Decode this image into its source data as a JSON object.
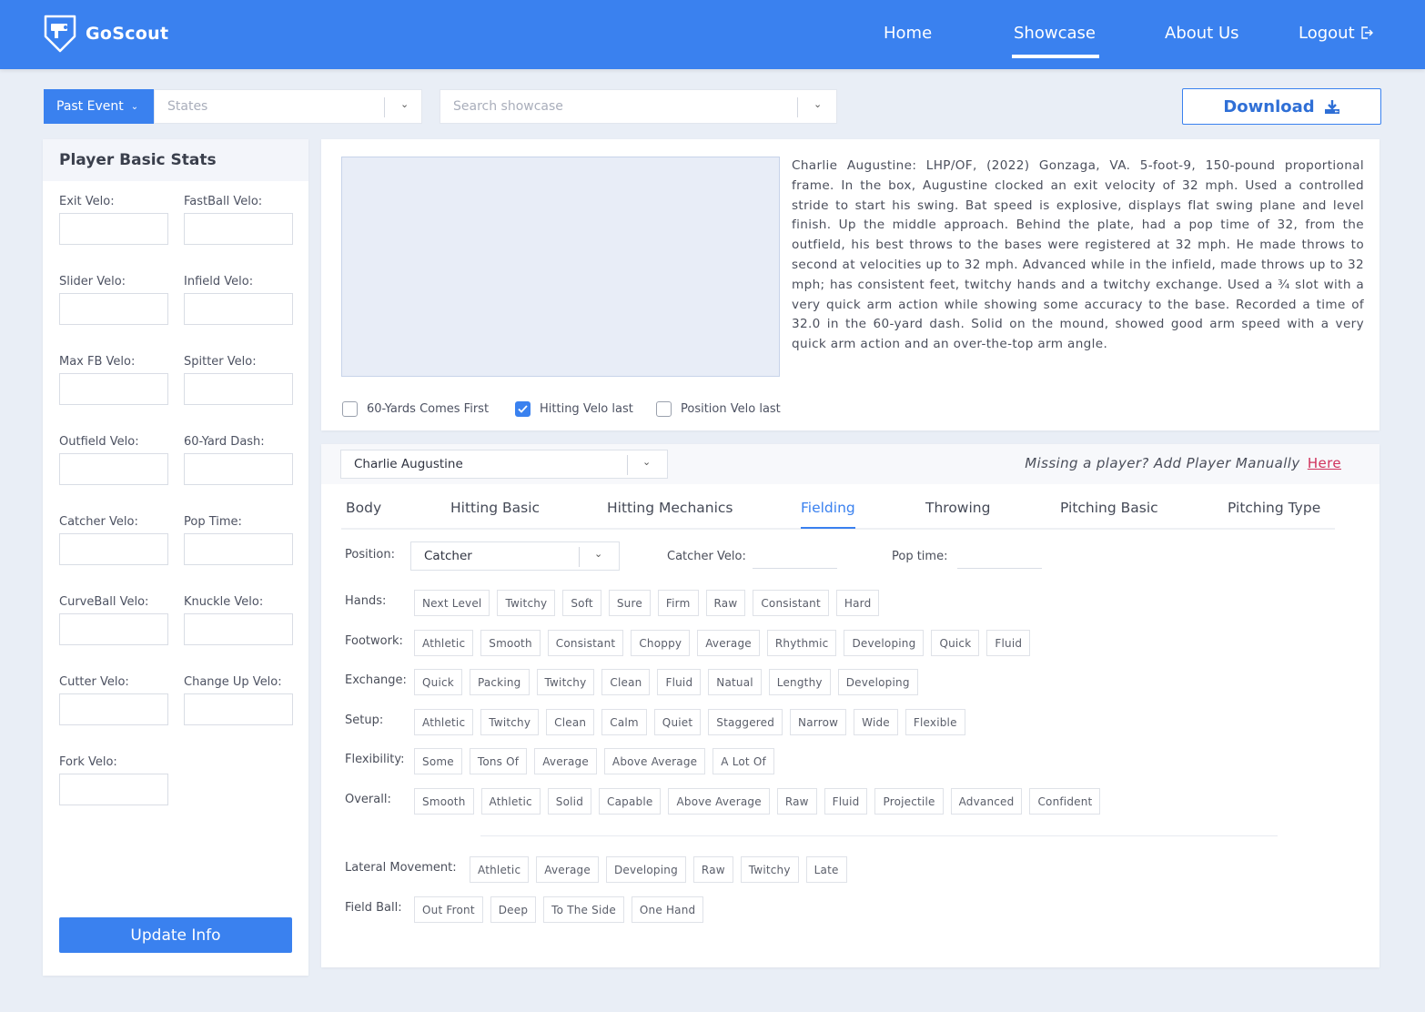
{
  "header": {
    "brand": "GoScout",
    "nav": [
      {
        "label": "Home",
        "active": false
      },
      {
        "label": "Showcase",
        "active": true
      },
      {
        "label": "About Us",
        "active": false
      },
      {
        "label": "Logout",
        "active": false
      }
    ]
  },
  "filters": {
    "event_label": "Past Event",
    "states_placeholder": "States",
    "search_placeholder": "Search showcase",
    "download_label": "Download"
  },
  "stats": {
    "title": "Player Basic Stats",
    "fields": [
      {
        "label": "Exit Velo:",
        "value": ""
      },
      {
        "label": "FastBall Velo:",
        "value": ""
      },
      {
        "label": "Slider Velo:",
        "value": ""
      },
      {
        "label": "Infield Velo:",
        "value": ""
      },
      {
        "label": "Max FB Velo:",
        "value": ""
      },
      {
        "label": "Spitter Velo:",
        "value": ""
      },
      {
        "label": "Outfield Velo:",
        "value": ""
      },
      {
        "label": "60-Yard Dash:",
        "value": ""
      },
      {
        "label": "Catcher Velo:",
        "value": ""
      },
      {
        "label": "Pop Time:",
        "value": ""
      },
      {
        "label": "CurveBall Velo:",
        "value": ""
      },
      {
        "label": "Knuckle Velo:",
        "value": ""
      },
      {
        "label": "Cutter Velo:",
        "value": ""
      },
      {
        "label": "Change Up Velo:",
        "value": ""
      },
      {
        "label": "Fork Velo:",
        "value": ""
      }
    ],
    "update_label": "Update Info"
  },
  "description": {
    "text": "Charlie Augustine: LHP/OF, (2022) Gonzaga, VA. 5-foot-9, 150-pound proportional frame. In the box, Augustine clocked an exit velocity of 32 mph. Used a controlled stride to start his swing. Bat speed is explosive, displays flat  swing plane and level finish. Up the middle approach. Behind the plate, had a pop time of 32, from the outfield, his best throws to the bases were registered at 32 mph. He made throws to second at velocities up to 32 mph. Advanced while in the infield, made throws up to 32 mph; has consistent feet, twitchy hands and a twitchy exchange. Used a ¾ slot with a very quick arm action while showing some accuracy to the base. Recorded a time of 32.0 in the 60-yard dash. Solid on the mound, showed good arm speed with a very quick arm action and an over-the-top arm angle.",
    "options": [
      {
        "label": "60-Yards Comes First",
        "checked": false
      },
      {
        "label": "Hitting Velo last",
        "checked": true
      },
      {
        "label": "Position Velo last",
        "checked": false
      }
    ]
  },
  "detail": {
    "player": "Charlie Augustine",
    "missing_text": "Missing a player? Add Player Manually",
    "missing_link": "Here",
    "tabs": [
      {
        "label": "Body",
        "active": false
      },
      {
        "label": "Hitting Basic",
        "active": false
      },
      {
        "label": "Hitting Mechanics",
        "active": false
      },
      {
        "label": "Fielding",
        "active": true
      },
      {
        "label": "Throwing",
        "active": false
      },
      {
        "label": "Pitching Basic",
        "active": false
      },
      {
        "label": "Pitching Type",
        "active": false
      }
    ],
    "position_label": "Position:",
    "position_value": "Catcher",
    "catcher_velo_label": "Catcher Velo:",
    "pop_time_label": "Pop time:",
    "groups": [
      {
        "label": "Hands:",
        "chips": [
          "Next Level",
          "Twitchy",
          "Soft",
          "Sure",
          "Firm",
          "Raw",
          "Consistant",
          "Hard"
        ]
      },
      {
        "label": "Footwork:",
        "chips": [
          "Athletic",
          "Smooth",
          "Consistant",
          "Choppy",
          "Average",
          "Rhythmic",
          "Developing",
          "Quick",
          "Fluid"
        ]
      },
      {
        "label": "Exchange:",
        "chips": [
          "Quick",
          "Packing",
          "Twitchy",
          "Clean",
          "Fluid",
          "Natual",
          "Lengthy",
          "Developing"
        ]
      },
      {
        "label": "Setup:",
        "chips": [
          "Athletic",
          "Twitchy",
          "Clean",
          "Calm",
          "Quiet",
          "Staggered",
          "Narrow",
          "Wide",
          "Flexible"
        ]
      },
      {
        "label": "Flexibility:",
        "chips": [
          "Some",
          "Tons Of",
          "Average",
          "Above Average",
          "A Lot Of"
        ]
      },
      {
        "label": "Overall:",
        "chips": [
          "Smooth",
          "Athletic",
          "Solid",
          "Capable",
          "Above Average",
          "Raw",
          "Fluid",
          "Projectile",
          "Advanced",
          "Confident"
        ]
      },
      {
        "label": "Lateral Movement:",
        "chips": [
          "Athletic",
          "Average",
          "Developing",
          "Raw",
          "Twitchy",
          "Late"
        ]
      },
      {
        "label": "Field Ball:",
        "chips": [
          "Out Front",
          "Deep",
          "To The Side",
          "One Hand"
        ]
      }
    ]
  }
}
